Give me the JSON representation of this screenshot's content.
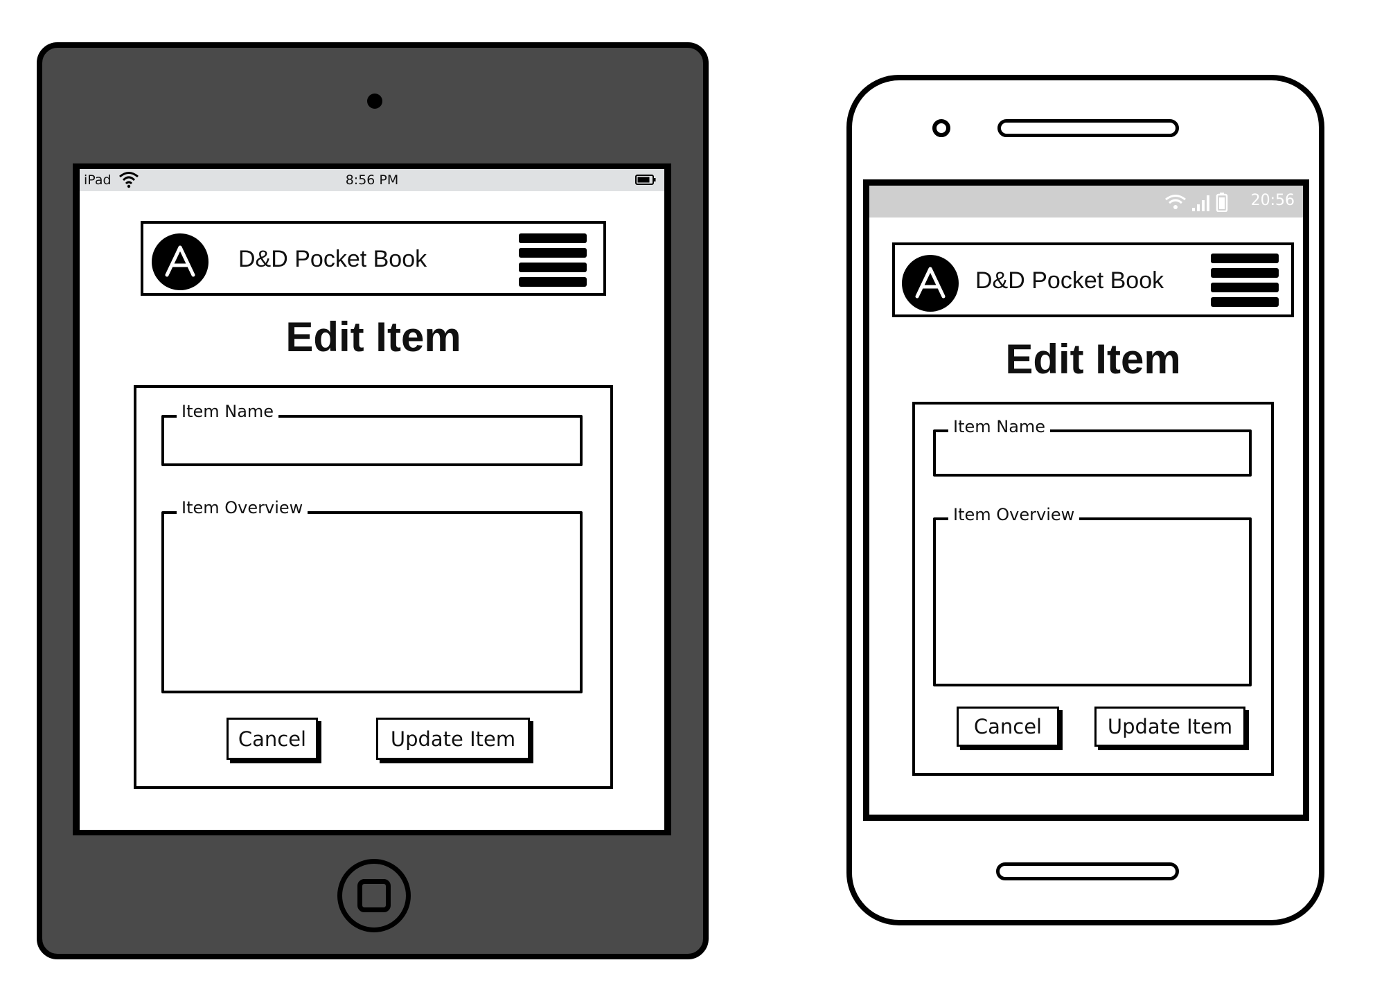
{
  "tablet": {
    "status_bar": {
      "carrier": "iPad",
      "time": "8:56 PM"
    },
    "header": {
      "app_title": "D&D Pocket Book"
    },
    "page_title": "Edit Item",
    "form": {
      "item_name_label": "Item Name",
      "item_name_value": "",
      "item_overview_label": "Item Overview",
      "item_overview_value": "",
      "cancel_label": "Cancel",
      "update_label": "Update Item"
    }
  },
  "phone": {
    "status_bar": {
      "time": "20:56"
    },
    "header": {
      "app_title": "D&D Pocket Book"
    },
    "page_title": "Edit Item",
    "form": {
      "item_name_label": "Item Name",
      "item_name_value": "",
      "item_overview_label": "Item Overview",
      "item_overview_value": "",
      "cancel_label": "Cancel",
      "update_label": "Update Item"
    }
  },
  "icons": {
    "logo": "ansible-logo-icon",
    "menu": "hamburger-menu-icon",
    "wifi": "wifi-icon",
    "signal": "cellular-signal-icon",
    "battery": "battery-icon",
    "home": "home-button-icon"
  },
  "colors": {
    "tablet_body": "#4a4a4a",
    "ios_status_bar": "#dfe1e3",
    "android_status_bar": "#cfcfcf",
    "ink": "#000000"
  }
}
